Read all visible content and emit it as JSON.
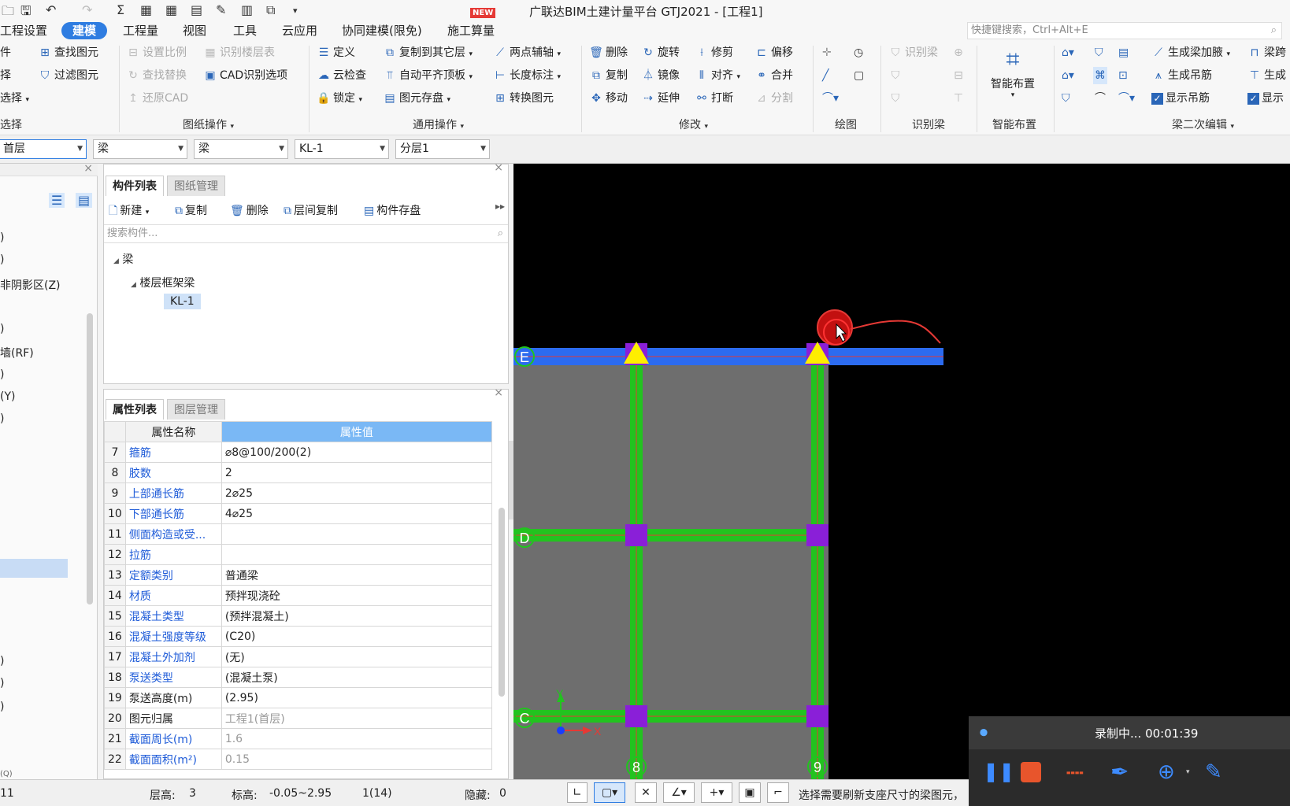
{
  "title": {
    "text": "广联达BIM土建计量平台 GTJ2021 - [工程1]",
    "new_badge": "NEW",
    "quick_icons": [
      "folder-icon",
      "save-icon",
      "undo-icon",
      "redo-icon",
      "sum-icon",
      "grid-icon"
    ]
  },
  "menu": {
    "items": [
      "工程设置",
      "建模",
      "工程量",
      "视图",
      "工具",
      "云应用",
      "协同建模(限免)",
      "施工算量"
    ],
    "active": "建模",
    "search_placeholder": "快捷键搜索，Ctrl+Alt+E"
  },
  "ribbon": {
    "col0": [
      "件",
      "择",
      "选择"
    ],
    "col0_group": "选择",
    "col1": [
      "查找图元",
      "过滤图元"
    ],
    "col2": [
      "设置比例",
      "查找替换",
      "还原CAD"
    ],
    "col3": [
      "识别楼层表",
      "CAD识别选项"
    ],
    "group_drawing": "图纸操作",
    "col4": [
      "定义",
      "云检查",
      "锁定"
    ],
    "col5": [
      "复制到其它层",
      "自动平齐顶板",
      "图元存盘"
    ],
    "col6": [
      "两点辅轴",
      "长度标注",
      "转换图元"
    ],
    "group_common": "通用操作",
    "col7": [
      "删除",
      "复制",
      "移动"
    ],
    "col8": [
      "旋转",
      "镜像",
      "延伸"
    ],
    "col9": [
      "修剪",
      "对齐",
      "打断"
    ],
    "col10": [
      "偏移",
      "合并",
      "分割"
    ],
    "group_modify": "修改",
    "group_draw": "绘图",
    "col11": [
      "识别梁"
    ],
    "group_recognize": "识别梁",
    "smart_layout": "智能布置",
    "group_smart": "智能布置",
    "col12": [
      "生成梁加腋",
      "生成吊筋",
      "显示吊筋"
    ],
    "col13": [
      "梁跨",
      "生成",
      "显示"
    ],
    "group_beam2": "梁二次编辑"
  },
  "selectors": [
    "首层",
    "梁",
    "梁",
    "KL-1",
    "分层1"
  ],
  "left_panel": {
    "items": [
      ")",
      ")",
      "非阴影区(Z)",
      ")",
      "墙(RF)",
      ")",
      "(Y)",
      ")",
      ")",
      ")",
      ")",
      "(Q)"
    ]
  },
  "component_panel": {
    "tabs": [
      "构件列表",
      "图纸管理"
    ],
    "toolbar": [
      "新建",
      "复制",
      "删除",
      "层间复制",
      "构件存盘"
    ],
    "search_placeholder": "搜索构件...",
    "tree": {
      "root": "梁",
      "child": "楼层框架梁",
      "leaf": "KL-1"
    }
  },
  "property_panel": {
    "tabs": [
      "属性列表",
      "图层管理"
    ],
    "headers": [
      "属性名称",
      "属性值"
    ],
    "rows": [
      {
        "n": "7",
        "k": "箍筋",
        "v": "⌀8@100/200(2)",
        "blue": true
      },
      {
        "n": "8",
        "k": "胶数",
        "v": "2",
        "blue": true
      },
      {
        "n": "9",
        "k": "上部通长筋",
        "v": "2⌀25",
        "blue": true
      },
      {
        "n": "10",
        "k": "下部通长筋",
        "v": "4⌀25",
        "blue": true
      },
      {
        "n": "11",
        "k": "侧面构造或受...",
        "v": "",
        "blue": true
      },
      {
        "n": "12",
        "k": "拉筋",
        "v": "",
        "blue": true
      },
      {
        "n": "13",
        "k": "定额类别",
        "v": "普通梁",
        "blue": true
      },
      {
        "n": "14",
        "k": "材质",
        "v": "预拌现浇砼",
        "blue": true
      },
      {
        "n": "15",
        "k": "混凝土类型",
        "v": "(预拌混凝土)",
        "blue": true
      },
      {
        "n": "16",
        "k": "混凝土强度等级",
        "v": "(C20)",
        "blue": true
      },
      {
        "n": "17",
        "k": "混凝土外加剂",
        "v": "(无)",
        "blue": true
      },
      {
        "n": "18",
        "k": "泵送类型",
        "v": "(混凝土泵)",
        "blue": true
      },
      {
        "n": "19",
        "k": "泵送高度(m)",
        "v": "(2.95)",
        "blue": false
      },
      {
        "n": "20",
        "k": "图元归属",
        "v": "工程1(首层)",
        "blue": false,
        "grey": true
      },
      {
        "n": "21",
        "k": "截面周长(m)",
        "v": "1.6",
        "blue": true,
        "grey": true
      },
      {
        "n": "22",
        "k": "截面面积(m²)",
        "v": "0.15",
        "blue": true,
        "grey": true
      }
    ]
  },
  "canvas": {
    "axis_labels": [
      "E",
      "D",
      "C",
      "8",
      "9"
    ],
    "axis_x": "X",
    "axis_y": "Y"
  },
  "status": {
    "floor_height_label": "层高:",
    "floor_height": "3",
    "elevation_label": "标高:",
    "elevation": "-0.05~2.95",
    "count": "1(14)",
    "hidden_label": "隐藏:",
    "hidden": "0",
    "left_num": "11",
    "hint": "选择需要刷新支座尺寸的梁图元，可以点选、框选，然后单击右键确定刷新支座尺寸"
  },
  "recorder": {
    "text": "录制中... 00:01:39"
  },
  "colors": {
    "accent": "#2f7de1",
    "beam_green": "#22c31f",
    "beam_blue": "#2c6bf0",
    "column": "#8a1fd8",
    "support": "#ffee00"
  }
}
